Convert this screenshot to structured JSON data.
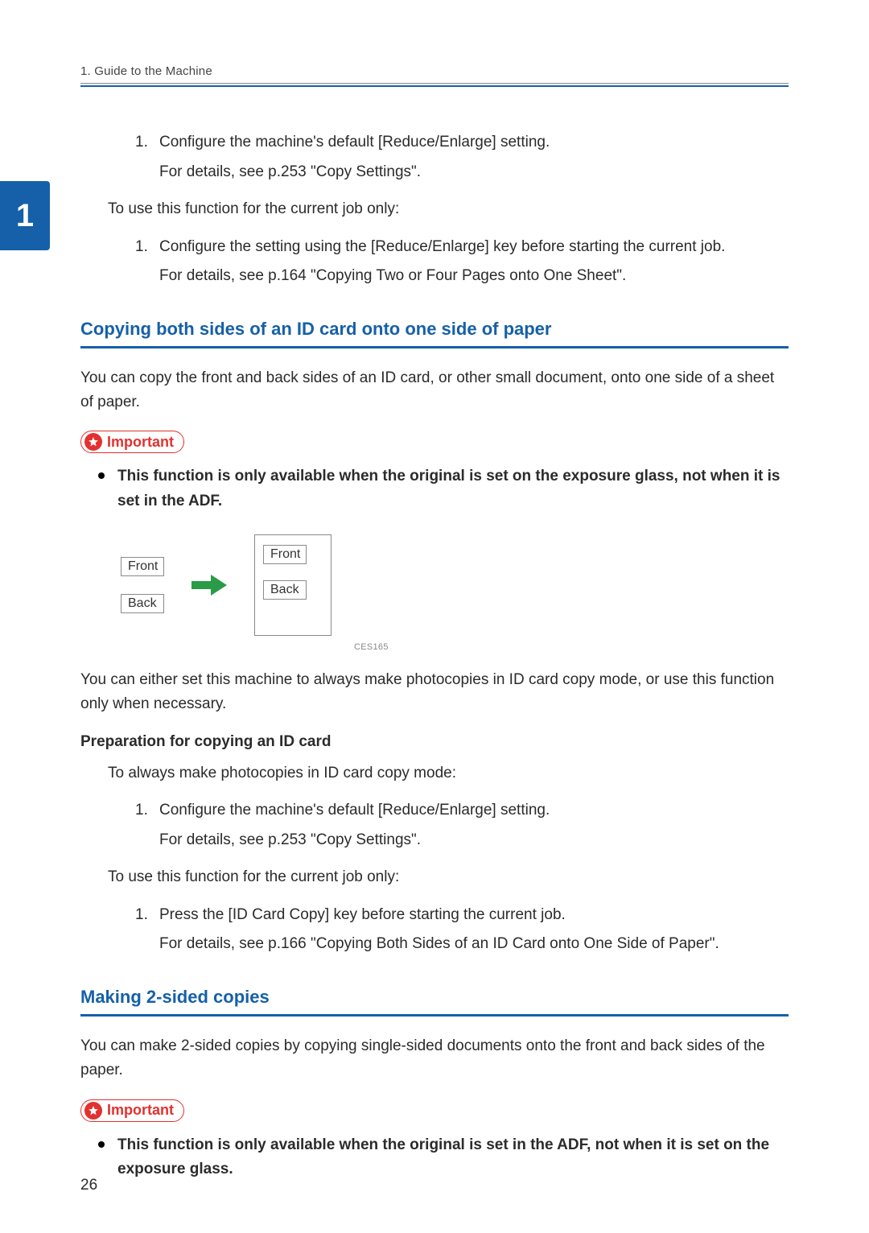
{
  "chapter_tab": "1",
  "running_head": "1. Guide to the Machine",
  "page_number": "26",
  "top": {
    "step1_num": "1.",
    "step1_text": "Configure the machine's default [Reduce/Enlarge] setting.",
    "step1_detail": "For details, see p.253 \"Copy Settings\".",
    "current_job_intro": "To use this function for the current job only:",
    "step2_num": "1.",
    "step2_text": "Configure the setting using the [Reduce/Enlarge] key before starting the current job.",
    "step2_detail": "For details, see p.164 \"Copying Two or Four Pages onto One Sheet\"."
  },
  "idcard": {
    "heading": "Copying both sides of an ID card onto one side of paper",
    "intro": "You can copy the front and back sides of an ID card, or other small document, onto one side of a sheet of paper.",
    "important_label": "Important",
    "important_bullet": "This function is only available when the original is set on the exposure glass, not when it is set in the ADF.",
    "fig_front": "Front",
    "fig_back": "Back",
    "fig_code": "CES165",
    "after_fig": "You can either set this machine to always make photocopies in ID card copy mode, or use this function only when necessary.",
    "prep_heading": "Preparation for copying an ID card",
    "always_intro": "To always make photocopies in ID card copy mode:",
    "always_step_num": "1.",
    "always_step_text": "Configure the machine's default [Reduce/Enlarge] setting.",
    "always_step_detail": "For details, see p.253 \"Copy Settings\".",
    "current_intro": "To use this function for the current job only:",
    "current_step_num": "1.",
    "current_step_text": "Press the [ID Card Copy] key before starting the current job.",
    "current_step_detail": "For details, see p.166 \"Copying Both Sides of an ID Card onto One Side of Paper\"."
  },
  "twosided": {
    "heading": "Making 2-sided copies",
    "intro": "You can make 2-sided copies by copying single-sided documents onto the front and back sides of the paper.",
    "important_label": "Important",
    "important_bullet": "This function is only available when the original is set in the ADF, not when it is set on the exposure glass."
  }
}
